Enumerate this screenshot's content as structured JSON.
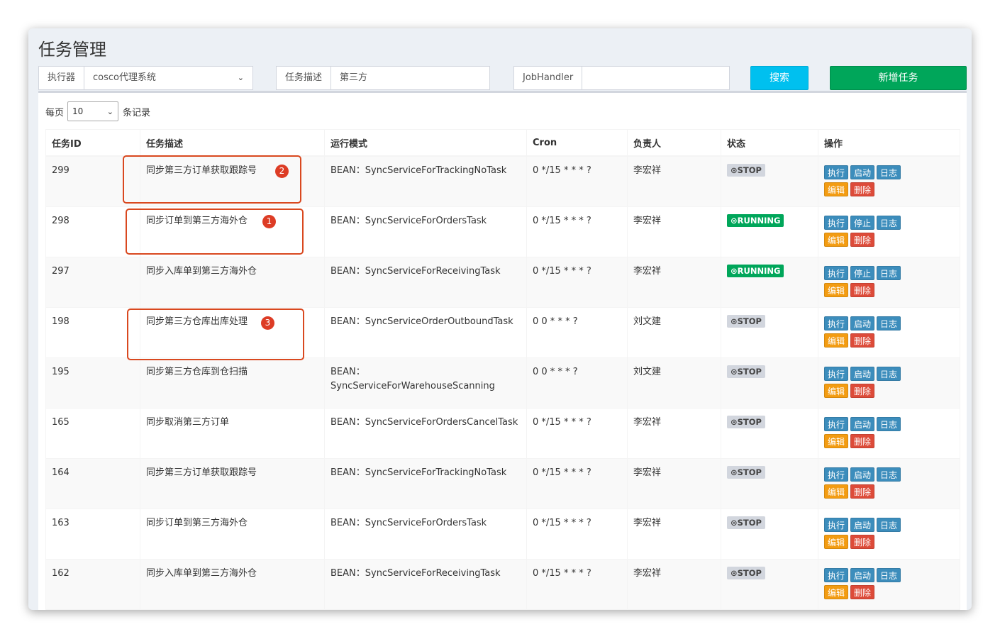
{
  "page": {
    "title": "任务管理"
  },
  "filters": {
    "executor_label": "执行器",
    "executor_value": "cosco代理系统",
    "desc_label": "任务描述",
    "desc_value": "第三方",
    "handler_label": "JobHandler",
    "handler_value": "",
    "search_label": "搜索",
    "add_label": "新增任务"
  },
  "length": {
    "prefix": "每页",
    "value": "10",
    "suffix": "条记录"
  },
  "table": {
    "headers": [
      "任务ID",
      "任务描述",
      "运行模式",
      "Cron",
      "负责人",
      "状态",
      "操作"
    ],
    "rows": [
      {
        "id": "299",
        "desc": "同步第三方订单获取跟踪号",
        "mode": "BEAN：SyncServiceForTrackingNoTask",
        "cron": "0 */15 * * * ?",
        "owner": "李宏祥",
        "status": "STOP",
        "toggle": "启动"
      },
      {
        "id": "298",
        "desc": "同步订单到第三方海外仓",
        "mode": "BEAN：SyncServiceForOrdersTask",
        "cron": "0 */15 * * * ?",
        "owner": "李宏祥",
        "status": "RUNNING",
        "toggle": "停止"
      },
      {
        "id": "297",
        "desc": "同步入库单到第三方海外仓",
        "mode": "BEAN：SyncServiceForReceivingTask",
        "cron": "0 */15 * * * ?",
        "owner": "李宏祥",
        "status": "RUNNING",
        "toggle": "停止"
      },
      {
        "id": "198",
        "desc": "同步第三方仓库出库处理",
        "mode": "BEAN：SyncServiceOrderOutboundTask",
        "cron": "0 0 * * * ?",
        "owner": "刘文建",
        "status": "STOP",
        "toggle": "启动"
      },
      {
        "id": "195",
        "desc": "同步第三方仓库到仓扫描",
        "mode": "BEAN：SyncServiceForWarehouseScanning",
        "cron": "0 0 * * * ?",
        "owner": "刘文建",
        "status": "STOP",
        "toggle": "启动"
      },
      {
        "id": "165",
        "desc": "同步取消第三方订单",
        "mode": "BEAN：SyncServiceForOrdersCancelTask",
        "cron": "0 */15 * * * ?",
        "owner": "李宏祥",
        "status": "STOP",
        "toggle": "启动"
      },
      {
        "id": "164",
        "desc": "同步第三方订单获取跟踪号",
        "mode": "BEAN：SyncServiceForTrackingNoTask",
        "cron": "0 */15 * * * ?",
        "owner": "李宏祥",
        "status": "STOP",
        "toggle": "启动"
      },
      {
        "id": "163",
        "desc": "同步订单到第三方海外仓",
        "mode": "BEAN：SyncServiceForOrdersTask",
        "cron": "0 */15 * * * ?",
        "owner": "李宏祥",
        "status": "STOP",
        "toggle": "启动"
      },
      {
        "id": "162",
        "desc": "同步入库单到第三方海外仓",
        "mode": "BEAN：SyncServiceForReceivingTask",
        "cron": "0 */15 * * * ?",
        "owner": "李宏祥",
        "status": "STOP",
        "toggle": "启动"
      }
    ]
  },
  "actions": {
    "execute": "执行",
    "log": "日志",
    "edit": "编辑",
    "delete": "删除"
  },
  "annotations": [
    "2",
    "1",
    "3"
  ],
  "colors": {
    "accent_search": "#00c0ef",
    "accent_add": "#00a65a",
    "running": "#00a65a",
    "stop": "#d2d6de",
    "action_blue": "#3c8dbc",
    "action_orange": "#f39c12",
    "action_red": "#dd4b39",
    "annotation": "#dd3c25"
  }
}
